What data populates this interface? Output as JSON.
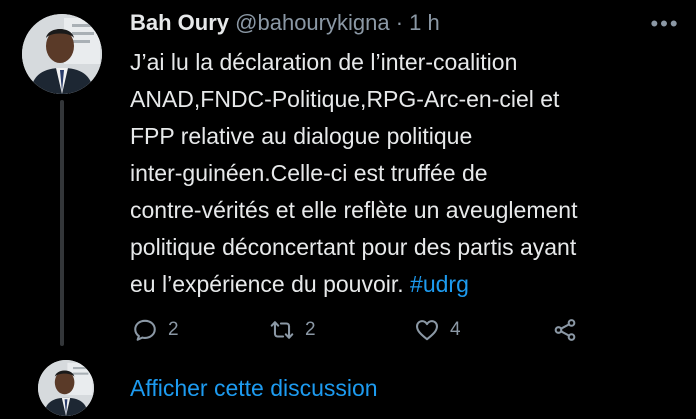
{
  "tweet": {
    "display_name": "Bah Oury",
    "handle": "@bahourykigna",
    "separator": "·",
    "timestamp": "1 h",
    "text_lines": [
      "J’ai lu la déclaration de l’inter-coalition",
      "ANAD,FNDC-Politique,RPG-Arc-en-ciel et",
      "FPP relative au dialogue politique",
      "inter-guinéen.Celle-ci est truffée de",
      "contre-vérités et elle reflète un aveuglement",
      "politique déconcertant pour des partis ayant",
      "eu l’expérience du pouvoir. "
    ],
    "hashtag": "#udrg",
    "actions": {
      "reply_icon": "reply-icon",
      "reply_count": "2",
      "retweet_icon": "retweet-icon",
      "retweet_count": "2",
      "like_icon": "heart-icon",
      "like_count": "4",
      "share_icon": "share-icon"
    },
    "more_icon": "more-horizontal-icon"
  },
  "thread": {
    "show_thread_label": "Afficher cette discussion"
  },
  "colors": {
    "background": "#000000",
    "text_primary": "#e7e9ea",
    "text_secondary": "#8b98a5",
    "link": "#1d9bf0",
    "thread_line": "#333639"
  }
}
